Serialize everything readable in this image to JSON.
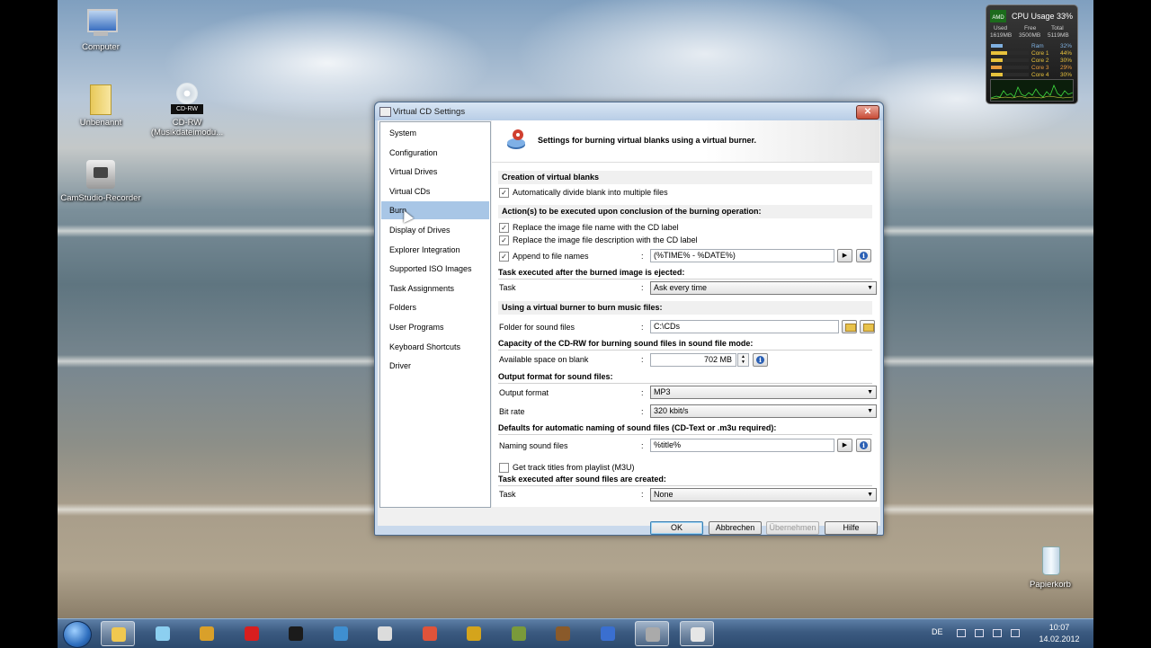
{
  "desktop": {
    "icons": [
      {
        "label": "Computer"
      },
      {
        "label": "Unbenannt"
      },
      {
        "label": "CD-RW",
        "label2": "(Musikdateimodu..."
      },
      {
        "label": "CamStudio-Recorder"
      },
      {
        "label": "Papierkorb"
      }
    ],
    "cd_badge": "CD-RW"
  },
  "gadget": {
    "brand": "AMD",
    "title": "CPU Usage",
    "percent": "33%",
    "mem_headers": [
      "Used",
      "Free",
      "Total"
    ],
    "mem_values": [
      "1619MB",
      "3500MB",
      "5119MB"
    ],
    "bars": [
      {
        "label": "Ram",
        "value": "32%",
        "level": 0.32,
        "color": "#7fb0e0"
      },
      {
        "label": "Core 1",
        "value": "44%",
        "level": 0.44,
        "color": "#e8c23c"
      },
      {
        "label": "Core 2",
        "value": "30%",
        "level": 0.3,
        "color": "#e8c23c"
      },
      {
        "label": "Core 3",
        "value": "29%",
        "level": 0.29,
        "color": "#e89a3c"
      },
      {
        "label": "Core 4",
        "value": "30%",
        "level": 0.3,
        "color": "#e8c23c"
      }
    ]
  },
  "dialog": {
    "title": "Virtual CD Settings",
    "close_glyph": "✕",
    "nav": [
      {
        "label": "System",
        "selected": false
      },
      {
        "label": "Configuration",
        "selected": false
      },
      {
        "label": "Virtual Drives",
        "selected": false
      },
      {
        "label": "Virtual CDs",
        "selected": false
      },
      {
        "label": "Burn",
        "selected": true
      },
      {
        "label": "Display of Drives",
        "selected": false
      },
      {
        "label": "Explorer Integration",
        "selected": false
      },
      {
        "label": "Supported ISO Images",
        "selected": false
      },
      {
        "label": "Task Assignments",
        "selected": false
      },
      {
        "label": "Folders",
        "selected": false
      },
      {
        "label": "User Programs",
        "selected": false
      },
      {
        "label": "Keyboard Shortcuts",
        "selected": false
      },
      {
        "label": "Driver",
        "selected": false
      }
    ],
    "header": "Settings for burning virtual blanks using a virtual burner.",
    "sections": {
      "creation": "Creation of virtual blanks",
      "actions": "Action(s) to be executed upon conclusion of the burning operation:",
      "task_after_burn": "Task executed after the burned image is ejected:",
      "music": "Using a virtual burner to burn music files:",
      "capacity": "Capacity of the CD-RW for burning sound files in sound file mode:",
      "output": "Output format for sound files:",
      "naming": "Defaults for automatic naming of sound files (CD-Text or .m3u required):",
      "task_after_sound": "Task executed after sound files are created:"
    },
    "checkboxes": {
      "divide": {
        "label": "Automatically divide blank into multiple files",
        "checked": true
      },
      "replace_name": {
        "label": "Replace the image file name with the CD label",
        "checked": true
      },
      "replace_desc": {
        "label": "Replace the image file description with the CD label",
        "checked": true
      },
      "append": {
        "label": "Append to file names",
        "checked": true
      },
      "track_titles": {
        "label": "Get track titles from playlist (M3U)",
        "checked": false
      }
    },
    "check_glyph": "✓",
    "colon": ":",
    "fields": {
      "append_value": "(%TIME% - %DATE%)",
      "task_label": "Task",
      "task_value": "Ask every time",
      "folder_label": "Folder for sound files",
      "folder_value": "C:\\CDs",
      "space_label": "Available space on blank",
      "space_value": "702 MB",
      "format_label": "Output format",
      "format_value": "MP3",
      "bitrate_label": "Bit rate",
      "bitrate_value": "320 kbit/s",
      "naming_label": "Naming sound files",
      "naming_value": "%title%",
      "task2_label": "Task",
      "task2_value": "None"
    },
    "glyphs": {
      "arrow_right": "▶",
      "arrow_down": "▼",
      "spin_up": "▲",
      "spin_down": "▼",
      "info": "i"
    },
    "buttons": {
      "ok": "OK",
      "cancel": "Abbrechen",
      "apply": "Übernehmen",
      "help": "Hilfe"
    }
  },
  "taskbar": {
    "apps": [
      {
        "name": "explorer",
        "color": "#f0c850",
        "active": true
      },
      {
        "name": "app-blue",
        "color": "#8ccff0",
        "active": false
      },
      {
        "name": "app-pen",
        "color": "#d9a02a",
        "active": false
      },
      {
        "name": "opera",
        "color": "#d81e1e",
        "active": false
      },
      {
        "name": "steam",
        "color": "#1b1b1b",
        "active": false
      },
      {
        "name": "app-globe",
        "color": "#3f8fd0",
        "active": false
      },
      {
        "name": "app-stormtrooper",
        "color": "#dcdcdc",
        "active": false
      },
      {
        "name": "app-bird",
        "color": "#e0533a",
        "active": false
      },
      {
        "name": "app-coins",
        "color": "#d4a41c",
        "active": false
      },
      {
        "name": "app-shield",
        "color": "#7a9a3a",
        "active": false
      },
      {
        "name": "app-warrior",
        "color": "#8a5a2a",
        "active": false
      },
      {
        "name": "itunes",
        "color": "#3a6fd0",
        "active": false
      },
      {
        "name": "camstudio",
        "color": "#aaaaaa",
        "active": true
      },
      {
        "name": "virtual-cd",
        "color": "#e6e6e6",
        "active": true
      }
    ],
    "lang": "DE",
    "time": "10:07",
    "date": "14.02.2012"
  }
}
